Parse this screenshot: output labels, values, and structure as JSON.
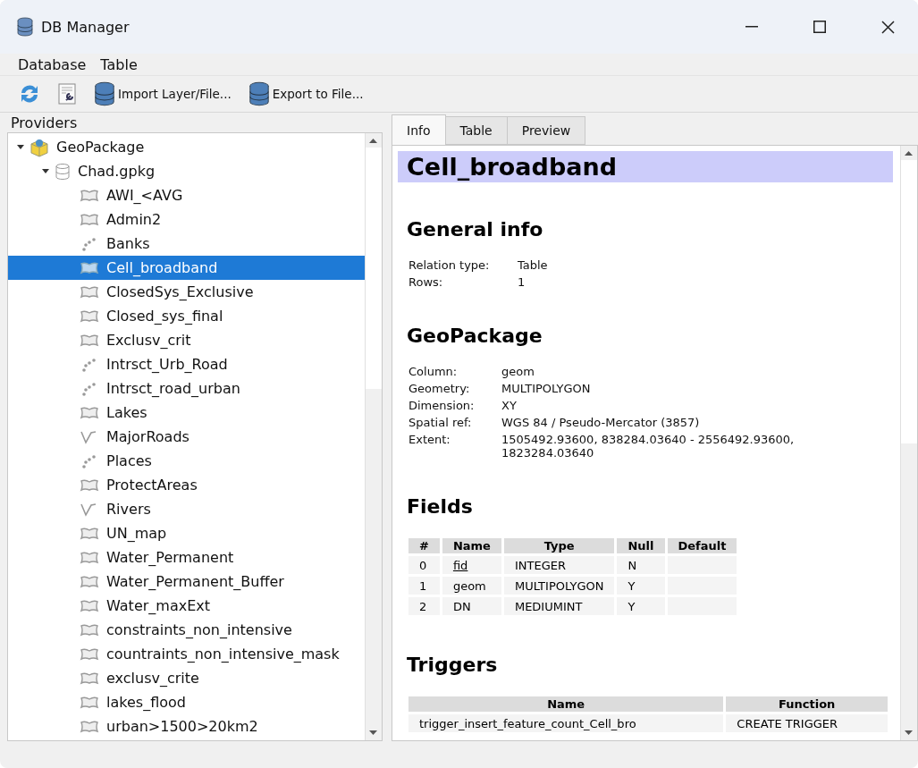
{
  "window": {
    "title": "DB Manager"
  },
  "menu": [
    "Database",
    "Table"
  ],
  "toolbar": [
    {
      "kind": "refresh"
    },
    {
      "kind": "sql"
    },
    {
      "kind": "import",
      "label": "Import Layer/File..."
    },
    {
      "kind": "export",
      "label": "Export to File..."
    }
  ],
  "providers": {
    "title": "Providers",
    "tree": [
      {
        "label": "GeoPackage",
        "kind": "provider",
        "expanded": true,
        "selected": false,
        "children": [
          {
            "label": "Chad.gpkg",
            "kind": "database",
            "expanded": true,
            "selected": false,
            "children": [
              {
                "label": "AWI_<AVG",
                "kind": "polygon",
                "selected": false
              },
              {
                "label": "Admin2",
                "kind": "polygon",
                "selected": false
              },
              {
                "label": "Banks",
                "kind": "point",
                "selected": false
              },
              {
                "label": "Cell_broadband",
                "kind": "polygon",
                "selected": true
              },
              {
                "label": "ClosedSys_Exclusive",
                "kind": "polygon",
                "selected": false
              },
              {
                "label": "Closed_sys_final",
                "kind": "polygon",
                "selected": false
              },
              {
                "label": "Exclusv_crit",
                "kind": "polygon",
                "selected": false
              },
              {
                "label": "Intrsct_Urb_Road",
                "kind": "point",
                "selected": false
              },
              {
                "label": "Intrsct_road_urban",
                "kind": "point",
                "selected": false
              },
              {
                "label": "Lakes",
                "kind": "polygon",
                "selected": false
              },
              {
                "label": "MajorRoads",
                "kind": "line",
                "selected": false
              },
              {
                "label": "Places",
                "kind": "point",
                "selected": false
              },
              {
                "label": "ProtectAreas",
                "kind": "polygon",
                "selected": false
              },
              {
                "label": "Rivers",
                "kind": "line",
                "selected": false
              },
              {
                "label": "UN_map",
                "kind": "polygon",
                "selected": false
              },
              {
                "label": "Water_Permanent",
                "kind": "polygon",
                "selected": false
              },
              {
                "label": "Water_Permanent_Buffer",
                "kind": "polygon",
                "selected": false
              },
              {
                "label": "Water_maxExt",
                "kind": "polygon",
                "selected": false
              },
              {
                "label": "constraints_non_intensive",
                "kind": "polygon",
                "selected": false
              },
              {
                "label": "countraints_non_intensive_mask",
                "kind": "polygon",
                "selected": false
              },
              {
                "label": "exclusv_crite",
                "kind": "polygon",
                "selected": false
              },
              {
                "label": "lakes_flood",
                "kind": "polygon",
                "selected": false
              },
              {
                "label": "urban>1500>20km2",
                "kind": "polygon",
                "selected": false
              }
            ]
          }
        ]
      }
    ]
  },
  "tabs": [
    {
      "label": "Info",
      "selected": true
    },
    {
      "label": "Table",
      "selected": false
    },
    {
      "label": "Preview",
      "selected": false
    }
  ],
  "info": {
    "title": "Cell_broadband",
    "general": {
      "heading": "General info",
      "rows": [
        {
          "label": "Relation type:",
          "value": "Table"
        },
        {
          "label": "Rows:",
          "value": "1"
        }
      ]
    },
    "geopackage": {
      "heading": "GeoPackage",
      "rows": [
        {
          "label": "Column:",
          "value": "geom"
        },
        {
          "label": "Geometry:",
          "value": "MULTIPOLYGON"
        },
        {
          "label": "Dimension:",
          "value": "XY"
        },
        {
          "label": "Spatial ref:",
          "value": "WGS 84 / Pseudo-Mercator (3857)"
        },
        {
          "label": "Extent:",
          "value": "1505492.93600, 838284.03640 - 2556492.93600, 1823284.03640"
        }
      ]
    },
    "fields": {
      "heading": "Fields",
      "columns": [
        "#",
        "Name",
        "Type",
        "Null",
        "Default"
      ],
      "rows": [
        {
          "cells": [
            "0",
            "fid",
            "INTEGER",
            "N"
          ],
          "primary_key": true
        },
        {
          "cells": [
            "1",
            "geom",
            "MULTIPOLYGON",
            "Y"
          ],
          "primary_key": false
        },
        {
          "cells": [
            "2",
            "DN",
            "MEDIUMINT",
            "Y"
          ],
          "primary_key": false
        }
      ]
    },
    "triggers": {
      "heading": "Triggers",
      "columns": [
        "Name",
        "Function"
      ],
      "rows": [
        [
          "trigger_insert_feature_count_Cell_bro",
          "CREATE TRIGGER"
        ]
      ]
    }
  }
}
